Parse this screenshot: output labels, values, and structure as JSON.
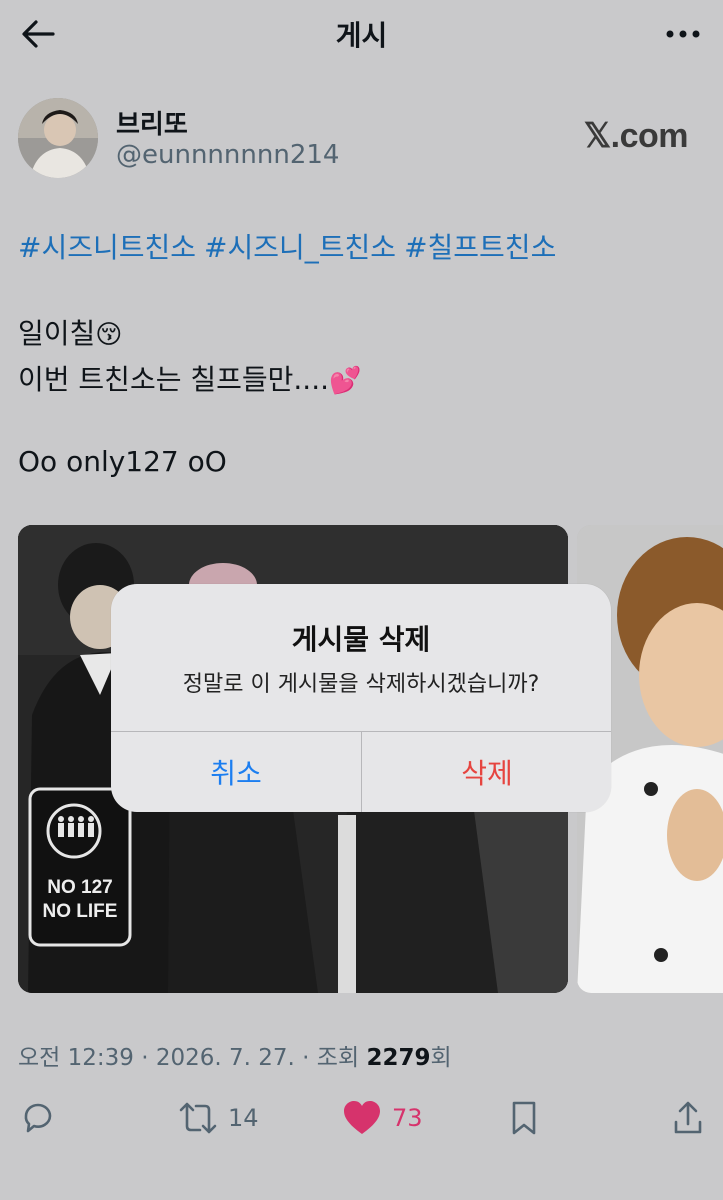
{
  "header": {
    "title": "게시"
  },
  "author": {
    "display_name": "브리또",
    "handle": "@eunnnnnnn214",
    "source_label": "𝕏.com"
  },
  "tweet": {
    "hashtags": [
      "#시즈니트친소",
      "#시즈니_트친소",
      "#칠프트친소"
    ],
    "line1": "일이칠",
    "line1_emoji": "😚",
    "line2": "이번 트친소는 칠프들만....",
    "line2_emoji": "💕",
    "line3": "Oo only127 oO",
    "media_sign_line1": "NO 127",
    "media_sign_line2": "NO LIFE"
  },
  "meta": {
    "time": "오전 12:39",
    "sep1": " · ",
    "date": "2026. 7. 27.",
    "sep2": " · ",
    "views_label": "조회 ",
    "views_count": "2279",
    "views_suffix": "회"
  },
  "actions": {
    "retweets": "14",
    "likes": "73"
  },
  "dialog": {
    "title": "게시물 삭제",
    "message": "정말로 이 게시물을 삭제하시겠습니까?",
    "cancel_label": "취소",
    "delete_label": "삭제"
  },
  "colors": {
    "hashtag": "#1d6fb8",
    "like": "#d6336c",
    "cancel": "#1c7ef0",
    "delete": "#e6443f"
  }
}
